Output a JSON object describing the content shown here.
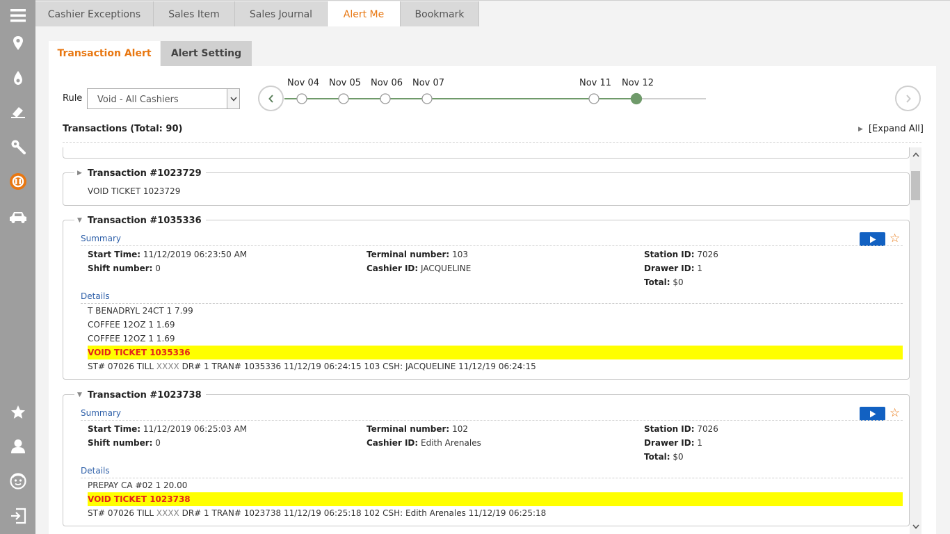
{
  "sidebar": {
    "items": [
      {
        "icon": "menu-icon"
      },
      {
        "icon": "location-pin-icon"
      },
      {
        "icon": "fuel-drop-icon"
      },
      {
        "icon": "eraser-icon"
      },
      {
        "icon": "wrench-icon"
      },
      {
        "icon": "alert-dashboard-icon",
        "active": true
      },
      {
        "icon": "car-icon"
      },
      {
        "icon": "star-icon"
      },
      {
        "icon": "user-icon"
      },
      {
        "icon": "support-face-icon"
      },
      {
        "icon": "logout-icon"
      }
    ],
    "colors": {
      "bar": "#9e9e9e",
      "icon": "#ffffff",
      "active": "#e87711"
    }
  },
  "top_tabs": [
    {
      "label": "Cashier Exceptions",
      "active": false
    },
    {
      "label": "Sales Item",
      "active": false
    },
    {
      "label": "Sales Journal",
      "active": false
    },
    {
      "label": "Alert Me",
      "active": true
    },
    {
      "label": "Bookmark",
      "active": false
    }
  ],
  "sub_tabs": [
    {
      "label": "Transaction Alert",
      "active": true
    },
    {
      "label": "Alert Setting",
      "active": false
    }
  ],
  "rule": {
    "label": "Rule",
    "selected": "Void - All Cashiers"
  },
  "timeline": {
    "dates": [
      {
        "label": "Nov 04",
        "selected": false
      },
      {
        "label": "Nov 05",
        "selected": false
      },
      {
        "label": "Nov 06",
        "selected": false
      },
      {
        "label": "Nov 07",
        "selected": false
      },
      {
        "label": "Nov 11",
        "selected": false
      },
      {
        "label": "Nov 12",
        "selected": true
      }
    ]
  },
  "transactions_header": {
    "title": "Transactions (Total: 90)",
    "expand_all": "[Expand All]"
  },
  "transactions": [
    {
      "title": "Transaction #1023729",
      "expanded": false,
      "preview": "VOID TICKET 1023729"
    },
    {
      "title": "Transaction #1035336",
      "expanded": true,
      "summary_label": "Summary",
      "details_label": "Details",
      "summary": {
        "start_time": {
          "label": "Start Time:",
          "value": "11/12/2019 06:23:50 AM"
        },
        "shift_number": {
          "label": "Shift number:",
          "value": "0"
        },
        "terminal_number": {
          "label": "Terminal number:",
          "value": "103"
        },
        "cashier_id": {
          "label": "Cashier ID:",
          "value": "JACQUELINE"
        },
        "station_id": {
          "label": "Station ID:",
          "value": "7026"
        },
        "drawer_id": {
          "label": "Drawer ID:",
          "value": "1"
        },
        "total": {
          "label": "Total:",
          "value": "$0"
        }
      },
      "details": [
        "T BENADRYL 24CT 1 7.99",
        "COFFEE 12OZ 1 1.69",
        "COFFEE 12OZ 1 1.69"
      ],
      "void_line": "VOID TICKET 1035336",
      "footer": {
        "pre": "ST# 07026 TILL",
        "masked": "XXXX",
        "post": "DR# 1 TRAN# 1035336 11/12/19 06:24:15 103 CSH: JACQUELINE 11/12/19 06:24:15"
      }
    },
    {
      "title": "Transaction #1023738",
      "expanded": true,
      "summary_label": "Summary",
      "details_label": "Details",
      "summary": {
        "start_time": {
          "label": "Start Time:",
          "value": "11/12/2019 06:25:03 AM"
        },
        "shift_number": {
          "label": "Shift number:",
          "value": "0"
        },
        "terminal_number": {
          "label": "Terminal number:",
          "value": "102"
        },
        "cashier_id": {
          "label": "Cashier ID:",
          "value": "Edith Arenales"
        },
        "station_id": {
          "label": "Station ID:",
          "value": "7026"
        },
        "drawer_id": {
          "label": "Drawer ID:",
          "value": "1"
        },
        "total": {
          "label": "Total:",
          "value": "$0"
        }
      },
      "details": [
        "PREPAY CA #02 1 20.00"
      ],
      "void_line": "VOID TICKET 1023738",
      "footer": {
        "pre": "ST# 07026 TILL",
        "masked": "XXXX",
        "post": "DR# 1 TRAN# 1023738 11/12/19 06:25:18 102 CSH: Edith Arenales 11/12/19 06:25:18"
      }
    }
  ],
  "colors": {
    "accent": "#e87711",
    "highlight": "#ffff00",
    "void_text": "#e4231b",
    "link_blue": "#2d5fa8",
    "play_button": "#1261c2",
    "timeline_green": "#6f9a6a"
  }
}
